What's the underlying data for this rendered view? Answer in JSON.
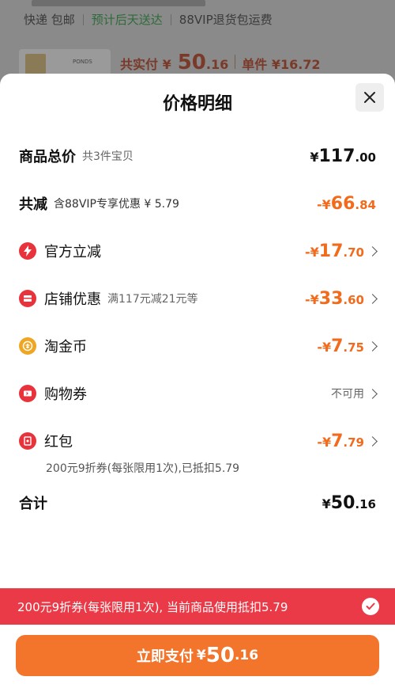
{
  "background": {
    "shipping": "快递 包邮",
    "delivery": "预计后天送达",
    "vip": "88VIP退货包运费",
    "thumb_brand": "PONDS",
    "total_label": "共实付 ¥",
    "total_int": "50",
    "total_dec": ".16",
    "unit_label": "单件 ¥16.72"
  },
  "sheet": {
    "title": "价格明细",
    "close_icon": "close-icon"
  },
  "rows": {
    "total": {
      "label": "商品总价",
      "sub": "共3件宝贝",
      "cur": "¥",
      "int": "117",
      "dec": ".00"
    },
    "discount": {
      "label": "共减",
      "sub": "含88VIP专享优惠 ¥ 5.79",
      "cur": "-¥",
      "int": "66",
      "dec": ".84"
    },
    "official": {
      "label": "官方立减",
      "cur": "-¥",
      "int": "17",
      "dec": ".70"
    },
    "shop": {
      "label": "店铺优惠",
      "sub": "满117元减21元等",
      "cur": "-¥",
      "int": "33",
      "dec": ".60"
    },
    "coins": {
      "label": "淘金币",
      "cur": "-¥",
      "int": "7",
      "dec": ".75"
    },
    "voucher": {
      "label": "购物券",
      "status": "不可用"
    },
    "redpacket": {
      "label": "红包",
      "cur": "-¥",
      "int": "7",
      "dec": ".79",
      "note": "200元9折券(每张限用1次),已抵扣5.79"
    },
    "sum": {
      "label": "合计",
      "cur": "¥",
      "int": "50",
      "dec": ".16"
    }
  },
  "banner": {
    "text": "200元9折券(每张限用1次), 当前商品使用抵扣5.79"
  },
  "pay": {
    "label": "立即支付",
    "cur": "¥",
    "int": "50",
    "dec": ".16"
  },
  "colors": {
    "accent": "#f26a1b",
    "banner": "#ea3a47",
    "pay": "#f2752b",
    "icon_red": "#e8323c",
    "icon_gold": "#f0a623"
  }
}
